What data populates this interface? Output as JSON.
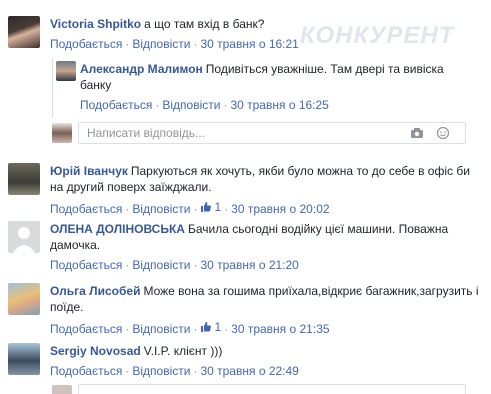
{
  "watermark": "КОНКУРЕНТ",
  "labels": {
    "like": "Подобається",
    "reply": "Відповісти",
    "dot": "·"
  },
  "comments": [
    {
      "author": "Victoria Shpitko",
      "text": "а що там вхід в банк?",
      "time": "30 травня о 16:21"
    },
    {
      "author": "Александр Малимон",
      "text": "Подивіться уважніше. Там двері та вивіска банку",
      "time": "30 травня о 16:25"
    },
    {
      "author": "Юрій Іванчук",
      "text": "Паркуються як хочуть, якби було можна то до себе в офіс би на другий поверх заїжджали.",
      "time": "30 травня о 20:02",
      "likes": "1"
    },
    {
      "author": "ОЛЕНА ДОЛІНОВСЬКА",
      "text": "Бачила сьогодні водійку цієї машини. Поважна дамочка.",
      "time": "30 травня о 21:20"
    },
    {
      "author": "Ольга Лисобей",
      "text": "Може вона за гошима приїхала,відкриє багажник,загрузить і поїде.",
      "time": "30 травня о 21:35",
      "likes": "1"
    },
    {
      "author": "Sergiy Novosad",
      "text": "V.I.P. клієнт )))",
      "time": "30 травня о 22:49"
    }
  ],
  "reply_box": {
    "placeholder": "Написати відповідь..."
  },
  "colors": {
    "link": "#365899",
    "action": "#4267b2",
    "meta": "#90949c",
    "text": "#1d2129"
  }
}
